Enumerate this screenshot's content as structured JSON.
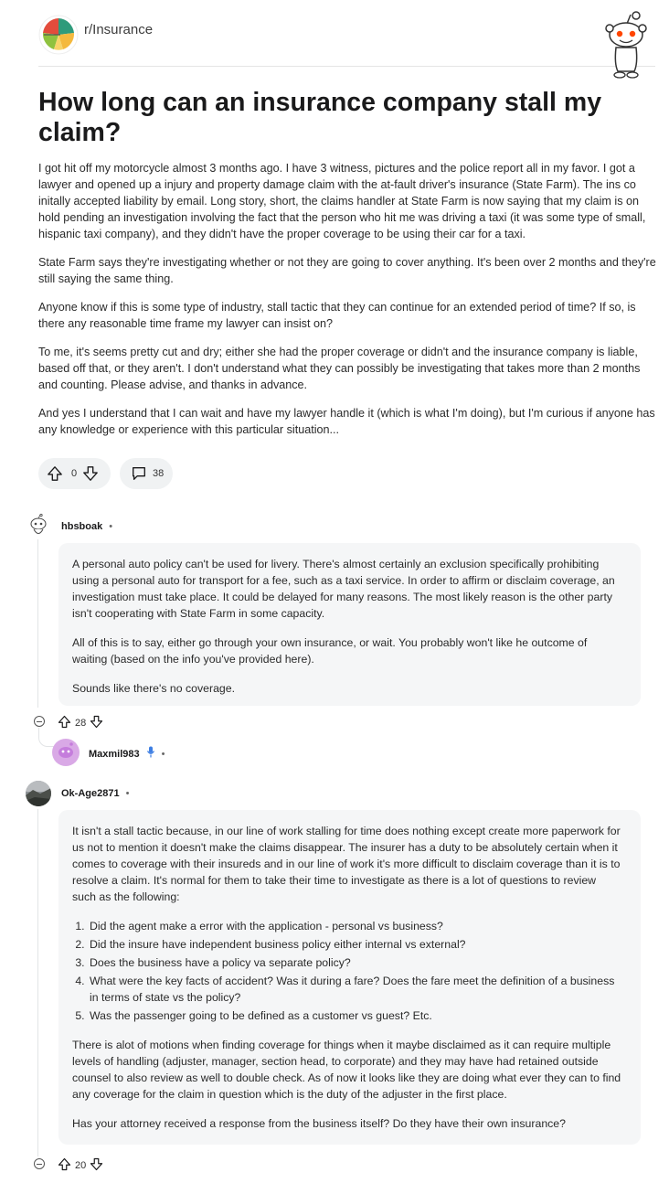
{
  "subreddit": {
    "name": "r/Insurance"
  },
  "post": {
    "title": "How long can an insurance company stall my claim?",
    "paragraphs": [
      "I got hit off my motorcycle almost 3 months ago. I have 3 witness, pictures and the police report all in my favor. I got a lawyer and opened up a injury and property damage claim with the at-fault driver's insurance (State Farm). The ins co initally accepted liability by email. Long story, short, the claims handler at State Farm is now saying that my claim is on hold pending an investigation involving the fact that the person who hit me was driving a taxi (it was some type of small, hispanic taxi company), and they didn't have the proper coverage to be using their car for a taxi.",
      "State Farm says they're investigating whether or not they are going to cover anything. It's been over 2 months and they're still saying the same thing.",
      "Anyone know if this is some type of industry, stall tactic that they can continue for an extended period of time? If so, is there any reasonable time frame my lawyer can insist on?",
      "To me, it's seems pretty cut and dry; either she had the proper coverage or didn't and the insurance company is liable, based off that, or they aren't. I don't understand what they can possibly be investigating that takes more than 2 months and counting. Please advise, and thanks in advance.",
      "And yes I understand that I can wait and have my lawyer handle it (which is what I'm doing), but I'm curious if anyone has any knowledge or experience with this particular situation..."
    ],
    "votes": "0",
    "comments": "38"
  },
  "comments": [
    {
      "username": "hbsboak",
      "paragraphs": [
        "A personal auto policy can't be used for livery. There's almost certainly an exclusion specifically prohibiting using a personal auto for transport for a fee, such as a taxi service. In order to affirm or disclaim coverage, an investigation must take place. It could be delayed for many reasons. The most likely reason is the other party isn't cooperating with State Farm in some capacity.",
        "All of this is to say, either go through your own insurance, or wait. You probably won't like he outcome of waiting (based on the info you've provided here).",
        "Sounds like there's no coverage."
      ],
      "votes": "28",
      "reply": {
        "username": "Maxmil983"
      }
    },
    {
      "username": "Ok-Age2871",
      "intro": "It isn't a stall tactic because, in our line of work stalling for time does nothing except create more paperwork for us not to mention it doesn't make the claims disappear. The insurer has a duty to be absolutely certain when it comes to coverage with their insureds and in our line of work it's more difficult to disclaim coverage than it is to resolve a claim. It's normal for them to take their time to investigate as there is a lot of questions to review such as the following:",
      "list": [
        "Did the agent make a error with the application - personal vs business?",
        "Did the insure have independent business policy either internal vs external?",
        "Does the business have a policy va separate policy?",
        "What were the key facts of accident? Was it during a fare? Does the fare meet the definition of a business in terms of state vs the policy?",
        "Was the passenger going to be defined as a customer vs guest? Etc."
      ],
      "para2": "There is alot of motions when finding coverage for things when it maybe disclaimed as it can require multiple levels of handling (adjuster, manager, section head, to corporate) and they may have had retained outside counsel to also review as well to double check. As of now it looks like they are doing what ever they can to find any coverage for the claim in question which is the duty of the adjuster in the first place.",
      "para3": "Has your attorney received a response from the business itself? Do they have their own insurance?",
      "votes": "20"
    }
  ],
  "icons": {
    "subreddit_avatar": "umbrella-icon",
    "mascot": "snoo-mascot-icon",
    "upvote": "upvote-arrow-icon",
    "downvote": "downvote-arrow-icon",
    "comment": "comment-bubble-icon",
    "collapse": "collapse-thread-icon",
    "mic": "microphone-icon"
  },
  "colors": {
    "accent": "#3d7ee3",
    "umbrella": [
      "#e34c3c",
      "#f4b93e",
      "#8fc23f",
      "#2f9b7b"
    ]
  }
}
